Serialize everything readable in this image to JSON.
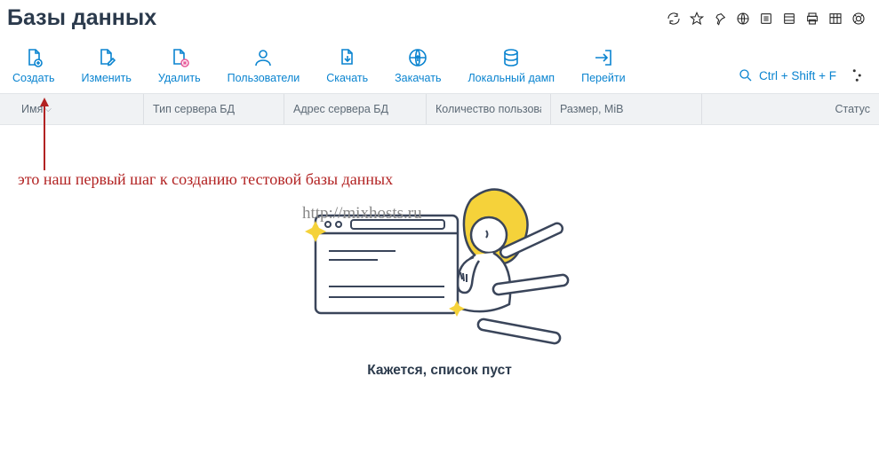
{
  "header": {
    "title": "Базы данных",
    "icons": [
      "refresh",
      "star",
      "pin",
      "globe",
      "list1",
      "list2",
      "print",
      "table",
      "help"
    ]
  },
  "toolbar": {
    "actions": [
      {
        "key": "create",
        "label": "Создать"
      },
      {
        "key": "edit",
        "label": "Изменить"
      },
      {
        "key": "delete",
        "label": "Удалить"
      },
      {
        "key": "users",
        "label": "Пользователи"
      },
      {
        "key": "download",
        "label": "Скачать"
      },
      {
        "key": "upload",
        "label": "Закачать"
      },
      {
        "key": "localdump",
        "label": "Локальный дамп"
      },
      {
        "key": "goto",
        "label": "Перейти"
      }
    ],
    "search_hint": "Ctrl + Shift + F"
  },
  "columns": {
    "name": "Имя",
    "type": "Тип сервера БД",
    "addr": "Адрес сервера БД",
    "users": "Количество пользователей",
    "size": "Размер, MiB",
    "status": "Статус"
  },
  "annotation": {
    "text": "это наш первый шаг к созданию тестовой базы данных"
  },
  "watermark": "http://mixhosts.ru",
  "empty_state": {
    "caption": "Кажется, список пуст"
  }
}
